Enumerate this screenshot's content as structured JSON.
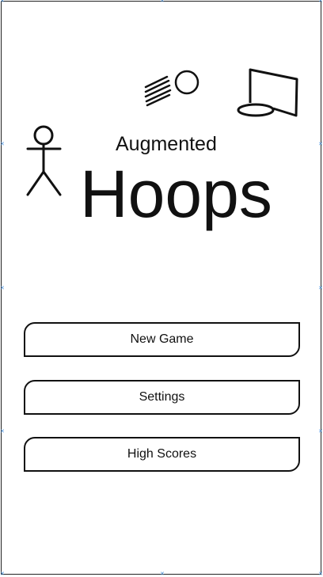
{
  "title": {
    "small": "Augmented",
    "big": "Hoops"
  },
  "menu": {
    "items": [
      {
        "label": "New Game"
      },
      {
        "label": "Settings"
      },
      {
        "label": "High Scores"
      }
    ]
  },
  "icons": [
    "stick-figure-icon",
    "basketball-icon",
    "hoop-icon"
  ],
  "colors": {
    "stroke": "#111111",
    "background": "#ffffff",
    "handle": "#4a90d9"
  }
}
